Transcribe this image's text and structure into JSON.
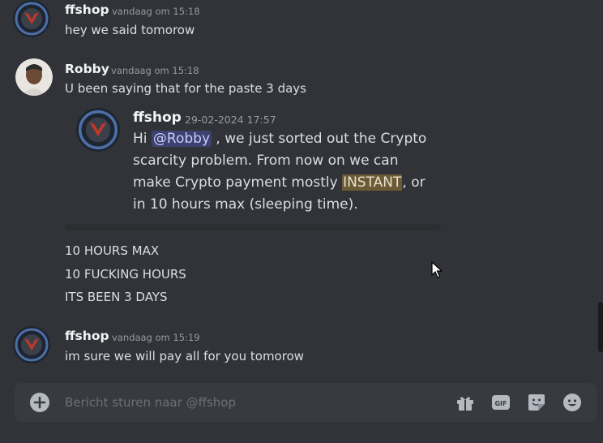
{
  "messages": [
    {
      "author": "ffshop",
      "time": "vandaag om 15:18",
      "lines": [
        "hey we said tomorow"
      ]
    },
    {
      "author": "Robby",
      "time": "vandaag om 15:18",
      "lines": [
        "U been saying that for the paste 3 days"
      ]
    },
    {
      "quote": {
        "author": "ffshop",
        "time": "29-02-2024 17:57",
        "line1_pre": "Hi ",
        "mention": "@Robby",
        "line1_post": " , we just sorted out the Crypto",
        "line2": "scarcity problem. From now on we can",
        "line3_pre": "make Crypto payment mostly ",
        "highlight": "INSTANT",
        "line3_post": ", or",
        "line4": "in 10 hours max (sleeping time)."
      }
    },
    {
      "lines": [
        "10 HOURS MAX",
        "10 FUCKING HOURS",
        "ITS BEEN 3 DAYS"
      ]
    },
    {
      "author": "ffshop",
      "time": "vandaag om 15:19",
      "lines": [
        "im sure we will pay all for you tomorow"
      ]
    }
  ],
  "composer": {
    "placeholder": "Bericht sturen naar @ffshop"
  },
  "colors": {
    "background": "#313338",
    "mention": "#5865f2",
    "highlight": "#6b5a33",
    "composer": "#383a40"
  },
  "icons": [
    "add-attachment-icon",
    "gift-icon",
    "gif-icon",
    "sticker-icon",
    "emoji-icon"
  ]
}
